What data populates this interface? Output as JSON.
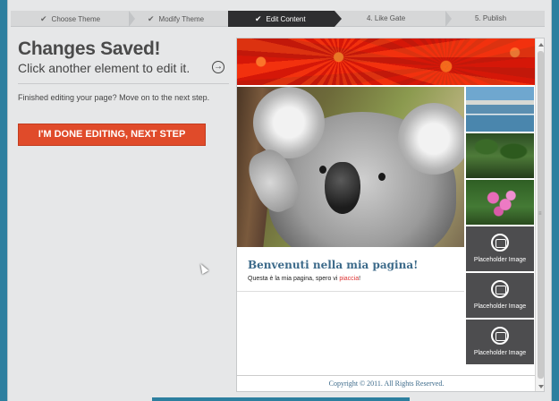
{
  "steps": [
    {
      "label": "Choose Theme",
      "done": true
    },
    {
      "label": "Modify Theme",
      "done": true
    },
    {
      "label": "Edit Content",
      "active": true
    },
    {
      "label": "4. Like Gate"
    },
    {
      "label": "5. Publish"
    }
  ],
  "panel": {
    "title": "Changes Saved!",
    "subtitle": "Click another element to edit it.",
    "info": "Finished editing your page? Move on to the next step.",
    "done_button": "I'M DONE EDITING, NEXT STEP"
  },
  "preview": {
    "welcome_title": "Benvenuti nella mia pagina!",
    "welcome_text_before": "Questa è la mia pagina, spero vi ",
    "welcome_text_highlight": "piaccia",
    "welcome_text_after": "!",
    "placeholders": [
      "Placeholder Image",
      "Placeholder Image",
      "Placeholder Image"
    ],
    "copyright": "Copyright © 2011. All Rights Reserved."
  },
  "icons": {
    "step_done": "check-icon",
    "subtitle_action": "circle-arrow-right-icon",
    "placeholder": "camera-icon"
  },
  "colors": {
    "accent": "#e04b2a",
    "active_step": "#2e2e30",
    "link": "#3c6a8a"
  }
}
